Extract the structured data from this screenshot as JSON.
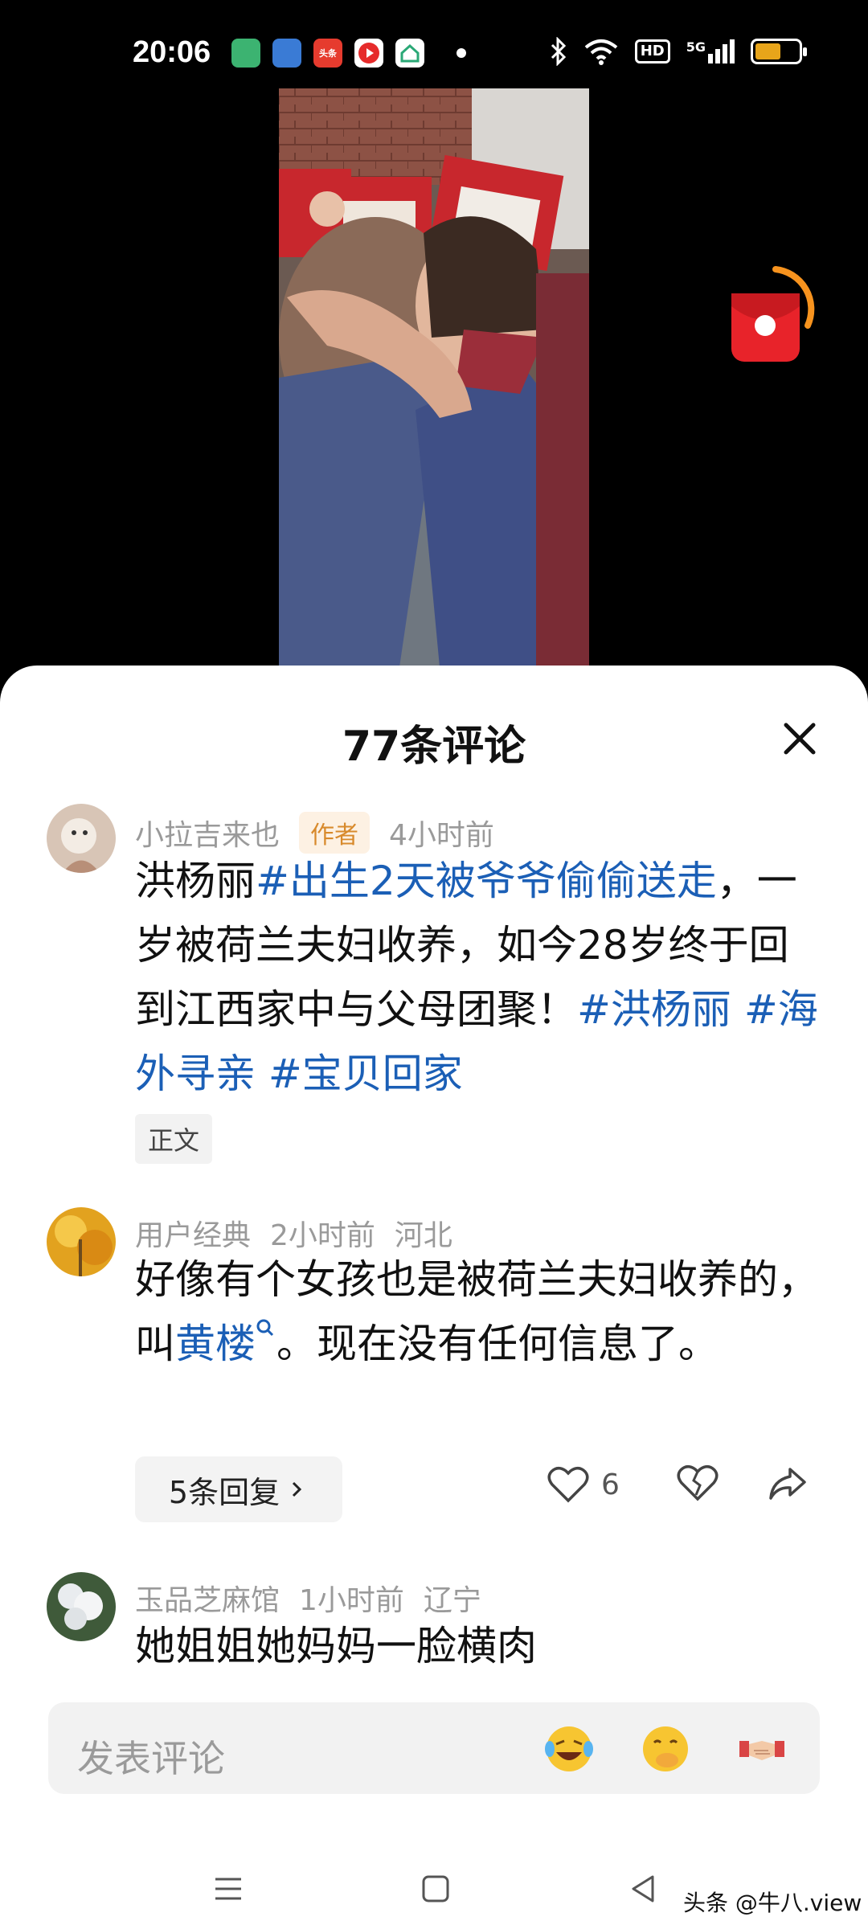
{
  "status_bar": {
    "time": "20:06",
    "apps": [
      "头条"
    ],
    "network": "5G",
    "hd": "HD",
    "battery_level": 0.6
  },
  "colors": {
    "accent_link": "#1b5fb6",
    "author_badge": "#d88a2c",
    "battery": "#e8a51a"
  },
  "panel": {
    "title": "77条评论"
  },
  "comments": [
    {
      "user": "小拉吉来也",
      "badge": "作者",
      "time": "4小时前",
      "text_parts": [
        "洪杨丽",
        "#出生2天被爷爷偷偷送走",
        "，一岁被荷兰夫妇收养，如今28岁终于回到江西家中与父母团聚！",
        "#洪杨丽",
        "#海外寻亲",
        "#宝贝回家"
      ],
      "label": "正文"
    },
    {
      "user": "用户经典",
      "time": "2小时前",
      "location": "河北",
      "text_before": "好像有个女孩也是被荷兰夫妇收养的，叫",
      "search_link": "黄楼",
      "text_after": "。现在没有任何信息了。",
      "replies": "5条回复",
      "likes": "6"
    },
    {
      "user": "玉品芝麻馆",
      "time": "1小时前",
      "location": "辽宁",
      "text": "她姐姐她妈妈一脸横肉"
    }
  ],
  "input": {
    "placeholder": "发表评论"
  },
  "watermark": "头条 @牛八.view"
}
